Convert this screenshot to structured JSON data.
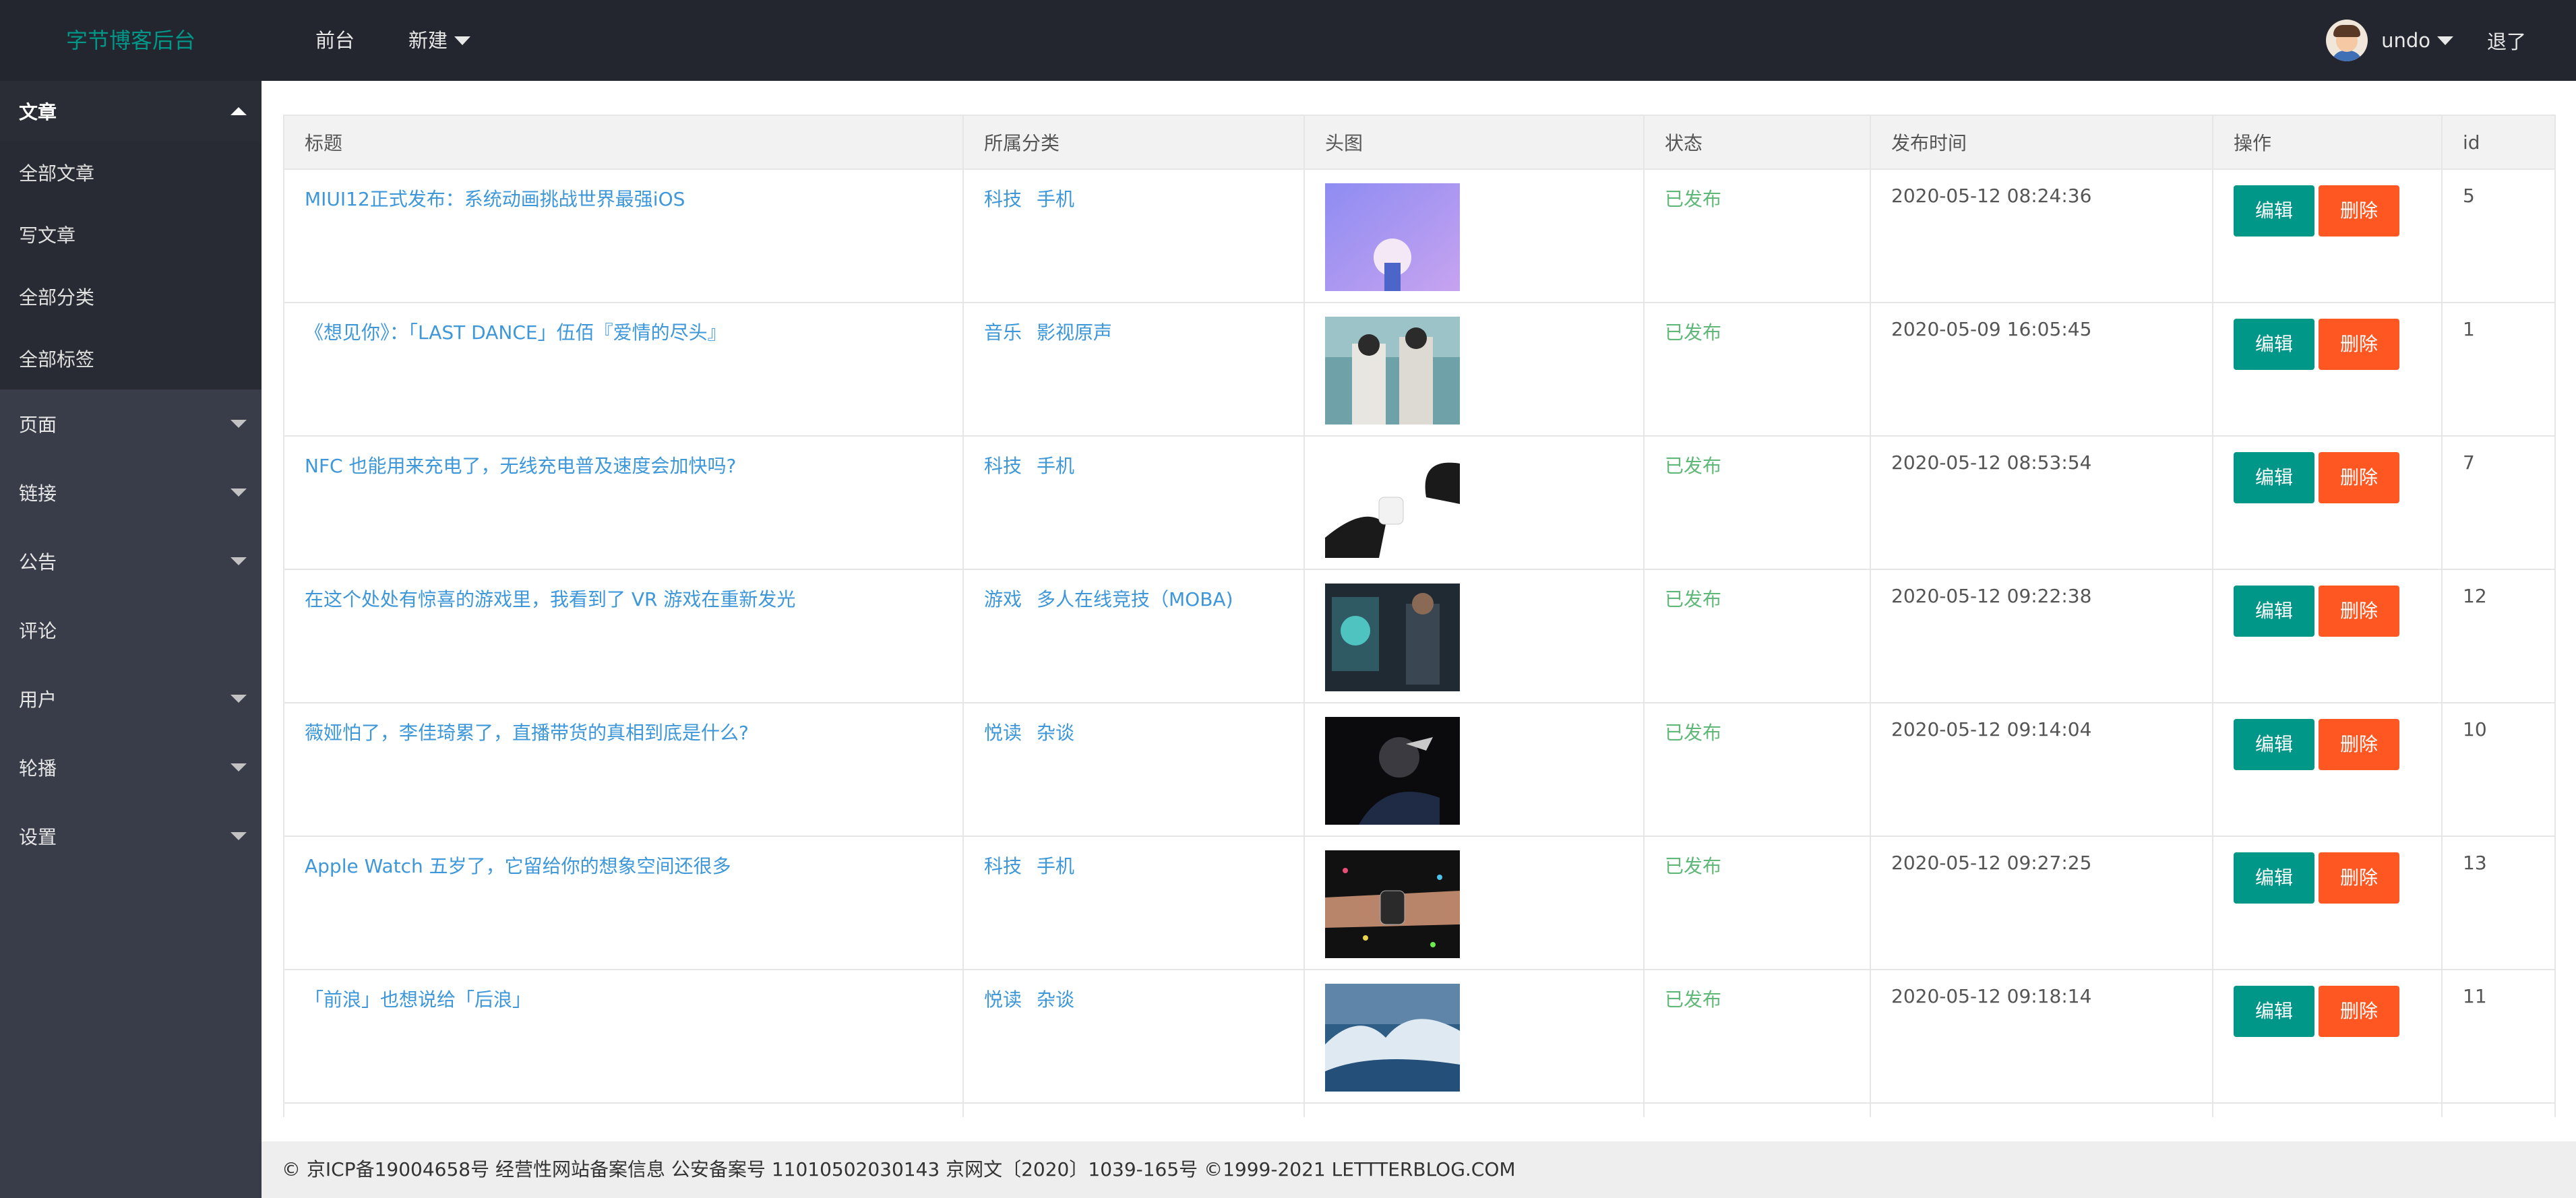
{
  "header": {
    "logo": "字节博客后台",
    "nav": [
      {
        "label": "前台",
        "has_caret": false
      },
      {
        "label": "新建",
        "has_caret": true
      }
    ],
    "user": "undo",
    "logout": "退了"
  },
  "sidebar": {
    "open_group": {
      "label": "文章",
      "items": [
        "全部文章",
        "写文章",
        "全部分类",
        "全部标签"
      ]
    },
    "groups": [
      {
        "label": "页面",
        "has_caret": true
      },
      {
        "label": "链接",
        "has_caret": true
      },
      {
        "label": "公告",
        "has_caret": true
      },
      {
        "label": "评论",
        "has_caret": false
      },
      {
        "label": "用户",
        "has_caret": true
      },
      {
        "label": "轮播",
        "has_caret": true
      },
      {
        "label": "设置",
        "has_caret": true
      }
    ]
  },
  "table": {
    "columns": [
      "标题",
      "所属分类",
      "头图",
      "状态",
      "发布时间",
      "操作",
      "id"
    ],
    "edit_label": "编辑",
    "delete_label": "删除",
    "rows": [
      {
        "title": "MIUI12正式发布：系统动画挑战世界最强iOS",
        "categories": [
          "科技",
          "手机"
        ],
        "status": "已发布",
        "date": "2020-05-12 08:24:36",
        "id": "5"
      },
      {
        "title": "《想见你》：「LAST DANCE」伍佰『爱情的尽头』",
        "categories": [
          "音乐",
          "影视原声"
        ],
        "status": "已发布",
        "date": "2020-05-09 16:05:45",
        "id": "1"
      },
      {
        "title": "NFC 也能用来充电了，无线充电普及速度会加快吗?",
        "categories": [
          "科技",
          "手机"
        ],
        "status": "已发布",
        "date": "2020-05-12 08:53:54",
        "id": "7"
      },
      {
        "title": "在这个处处有惊喜的游戏里，我看到了 VR 游戏在重新发光",
        "categories": [
          "游戏",
          "多人在线竞技（MOBA)"
        ],
        "status": "已发布",
        "date": "2020-05-12 09:22:38",
        "id": "12"
      },
      {
        "title": "薇娅怕了，李佳琦累了，直播带货的真相到底是什么?",
        "categories": [
          "悦读",
          "杂谈"
        ],
        "status": "已发布",
        "date": "2020-05-12 09:14:04",
        "id": "10"
      },
      {
        "title": "Apple Watch 五岁了，它留给你的想象空间还很多",
        "categories": [
          "科技",
          "手机"
        ],
        "status": "已发布",
        "date": "2020-05-12 09:27:25",
        "id": "13"
      },
      {
        "title": "「前浪」也想说给「后浪」",
        "categories": [
          "悦读",
          "杂谈"
        ],
        "status": "已发布",
        "date": "2020-05-12 09:18:14",
        "id": "11"
      }
    ]
  },
  "footer": {
    "text": "© 京ICP备19004658号 经营性网站备案信息 公安备案号 11010502030143 京网文〔2020〕1039-165号 ©1999-2021 LETTTERBLOG.COM"
  },
  "colors": {
    "header_bg": "#23262e",
    "sidebar_bg": "#393d49",
    "accent": "#009688",
    "danger": "#ff5722",
    "link": "#3d97d8",
    "status_ok": "#5fb878"
  }
}
